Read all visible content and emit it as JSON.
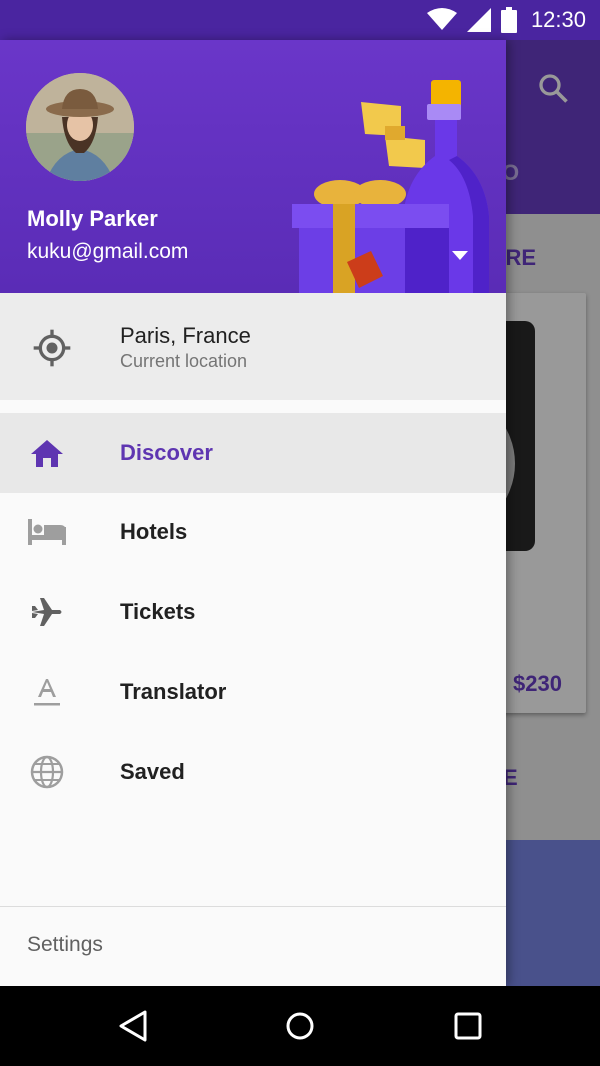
{
  "status_bar": {
    "time": "12:30"
  },
  "background": {
    "tab_fragment": "DIO",
    "more_1": "MORE",
    "price": "$230",
    "more_2": "ORE"
  },
  "drawer": {
    "user": {
      "name": "Molly Parker",
      "email": "kuku@gmail.com"
    },
    "location": {
      "title": "Paris, France",
      "subtitle": "Current location",
      "icon": "my-location-icon"
    },
    "items": [
      {
        "label": "Discover",
        "icon": "home-icon",
        "selected": true
      },
      {
        "label": "Hotels",
        "icon": "hotel-bed-icon",
        "selected": false
      },
      {
        "label": "Tickets",
        "icon": "airplane-icon",
        "selected": false
      },
      {
        "label": "Translator",
        "icon": "translate-icon",
        "selected": false
      },
      {
        "label": "Saved",
        "icon": "globe-icon",
        "selected": false
      }
    ],
    "settings_label": "Settings"
  },
  "colors": {
    "accent": "#5e35b1",
    "header": "#6a36c9",
    "status_bar": "#4a25a0"
  }
}
